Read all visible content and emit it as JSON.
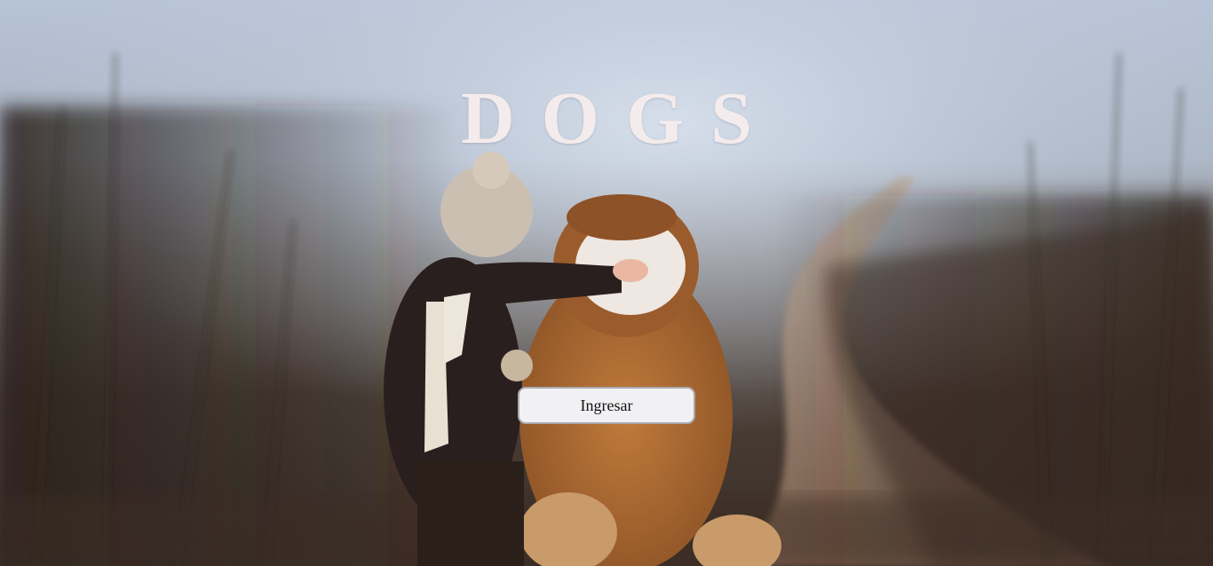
{
  "hero": {
    "title": "DOGS",
    "background_image": "child-hugging-dog-on-foggy-dirt-road"
  },
  "actions": {
    "enter_label": "Ingresar"
  }
}
